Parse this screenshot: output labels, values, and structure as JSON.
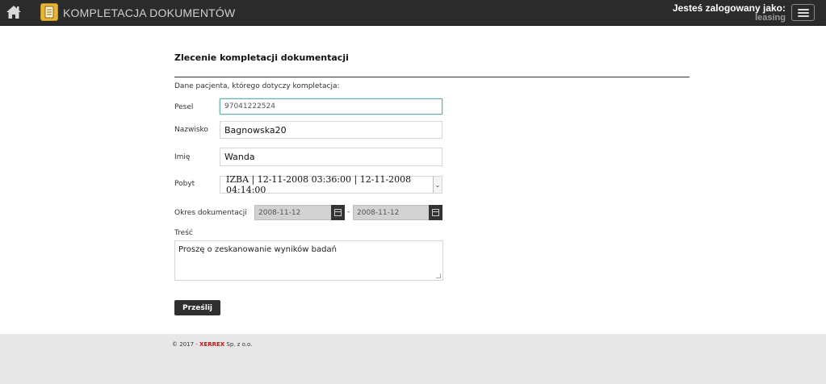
{
  "header": {
    "home_icon": "home-icon",
    "logo_icon": "document-icon",
    "title": "KOMPLETACJA DOKUMENTÓW",
    "user_label": "Jesteś zalogowany jako:",
    "user_name": "leasing",
    "menu_icon": "hamburger-menu-icon"
  },
  "form": {
    "title": "Zlecenie kompletacji dokumentacji",
    "intro": "Dane pacjenta, którego dotyczy kompletacja:",
    "pesel": {
      "label": "Pesel",
      "value": "97041222524"
    },
    "nazwisko": {
      "label": "Nazwisko",
      "value": "Bagnowska20"
    },
    "imie": {
      "label": "Imię",
      "value": "Wanda"
    },
    "pobyt": {
      "label": "Pobyt",
      "value": "IZBA | 12-11-2008 03:36:00 | 12-11-2008 04:14:00"
    },
    "okres": {
      "label": "Okres dokumentacji",
      "from": "2008-11-12",
      "separator": "-",
      "to": "2008-11-12"
    },
    "tresc": {
      "label": "Treść",
      "value": "Proszę o zeskanowanie wyników badań"
    },
    "submit_label": "Prześlij"
  },
  "footer": {
    "prefix": "© 2017 - ",
    "brand": "XERREX",
    "suffix": " Sp. z o.o."
  },
  "colors": {
    "topbar": "#2b2b2b",
    "logo": "#e7b437",
    "focus_border": "#66afa9",
    "footer_brand": "#b51a1a",
    "button": "#2f2f2f"
  }
}
